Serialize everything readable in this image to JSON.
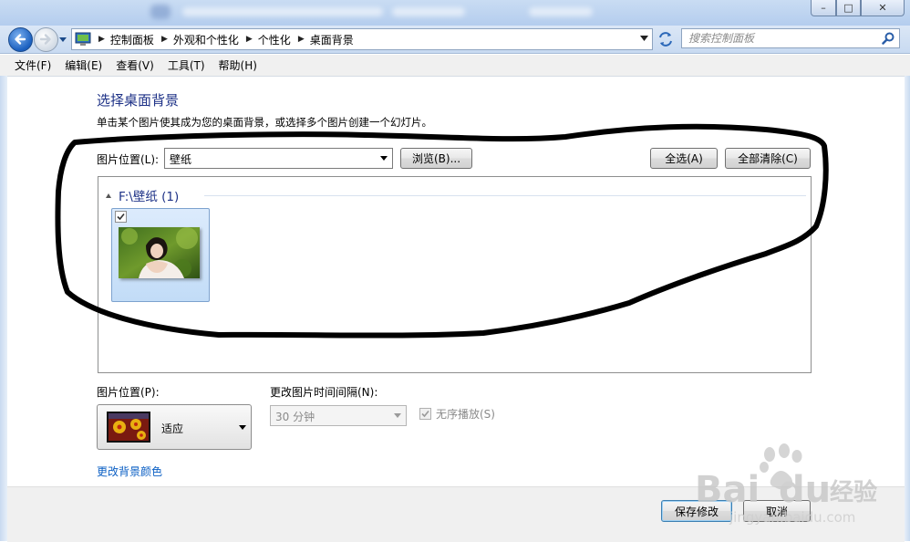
{
  "window": {
    "controls": {
      "minimize": "–",
      "maximize": "□",
      "close": "✕"
    }
  },
  "nav": {
    "breadcrumbs": [
      "控制面板",
      "外观和个性化",
      "个性化",
      "桌面背景"
    ],
    "search_placeholder": "搜索控制面板"
  },
  "menu": {
    "items": [
      "文件(F)",
      "编辑(E)",
      "查看(V)",
      "工具(T)",
      "帮助(H)"
    ]
  },
  "content": {
    "title": "选择桌面背景",
    "subtitle": "单击某个图片使其成为您的桌面背景，或选择多个图片创建一个幻灯片。",
    "location_label": "图片位置(L):",
    "location_value": "壁纸",
    "browse_button": "浏览(B)...",
    "select_all_button": "全选(A)",
    "clear_all_button": "全部清除(C)",
    "group_title": "F:\\壁纸 (1)",
    "thumbnail_checked": true,
    "position_label": "图片位置(P):",
    "position_value": "适应",
    "interval_label": "更改图片时间间隔(N):",
    "interval_value": "30 分钟",
    "shuffle_label": "无序播放(S)",
    "shuffle_checked": true,
    "bg_color_link": "更改背景颜色"
  },
  "footer": {
    "save_button": "保存修改",
    "cancel_button": "取消"
  },
  "watermark": {
    "brand": "Bai",
    "brand2": "du",
    "suffix": "经验",
    "url": "jingyan.baidu.com"
  },
  "colors": {
    "title_blue": "#1e3287",
    "link_blue": "#0b5fc4",
    "annotation": "#000000"
  }
}
